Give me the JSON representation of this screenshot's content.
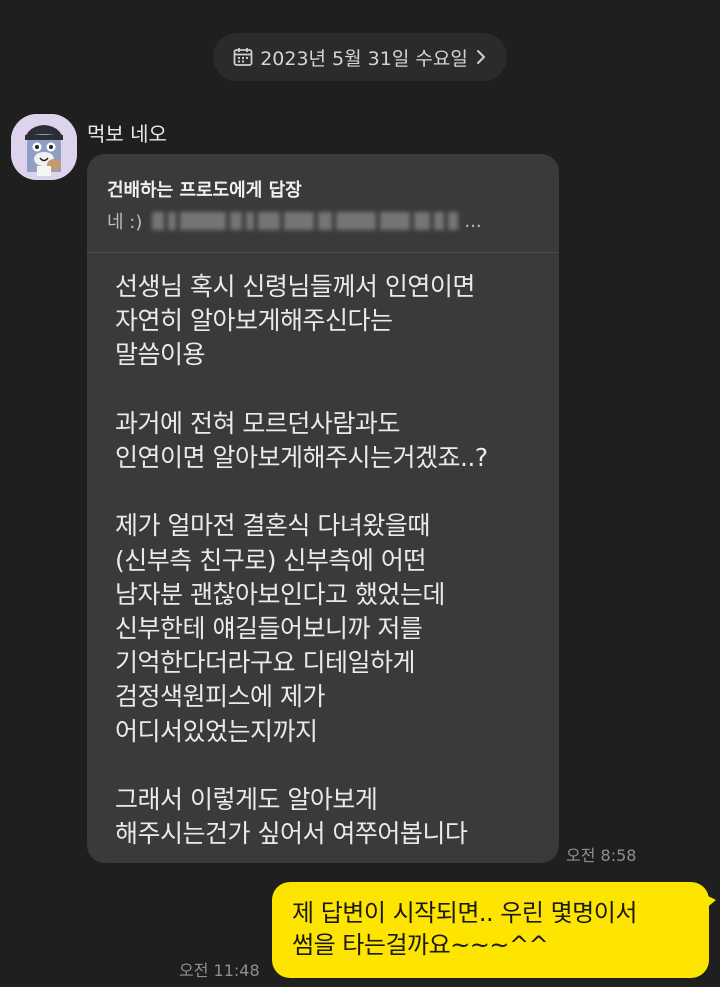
{
  "date_divider": {
    "label": "2023년 5월 31일 수요일"
  },
  "incoming": {
    "sender_name": "먹보 네오",
    "reply": {
      "title": "건배하는 프로도에게 답장",
      "quote_prefix": "네 :)",
      "quote_suffix": "..."
    },
    "text": "선생님 혹시 신령님들께서 인연이면\n자연히 알아보게해주신다는\n말씀이용\n\n과거에 전혀 모르던사람과도\n인연이면 알아보게해주시는거겠죠..?\n\n제가 얼마전 결혼식 다녀왔을때\n(신부측 친구로) 신부측에 어떤\n남자분 괜찮아보인다고 했었는데\n신부한테 얘길들어보니까 저를\n기억한다더라구요 디테일하게\n검정색원피스에 제가\n어디서있었는지까지\n\n그래서 이렇게도 알아보게\n해주시는건가 싶어서 여쭈어봅니다",
    "time": "오전 8:58"
  },
  "outgoing": {
    "text": "제 답변이 시작되면.. 우린 몇명이서\n썸을 타는걸까요~~~^^",
    "time": "오전 11:48"
  },
  "colors": {
    "background": "#1f1f1f",
    "incoming_bubble": "#3a3a3a",
    "outgoing_bubble": "#fee500",
    "date_pill": "#2b2b2b"
  },
  "icons": {
    "date": "calendar-icon",
    "chevron": "chevron-right-icon"
  }
}
